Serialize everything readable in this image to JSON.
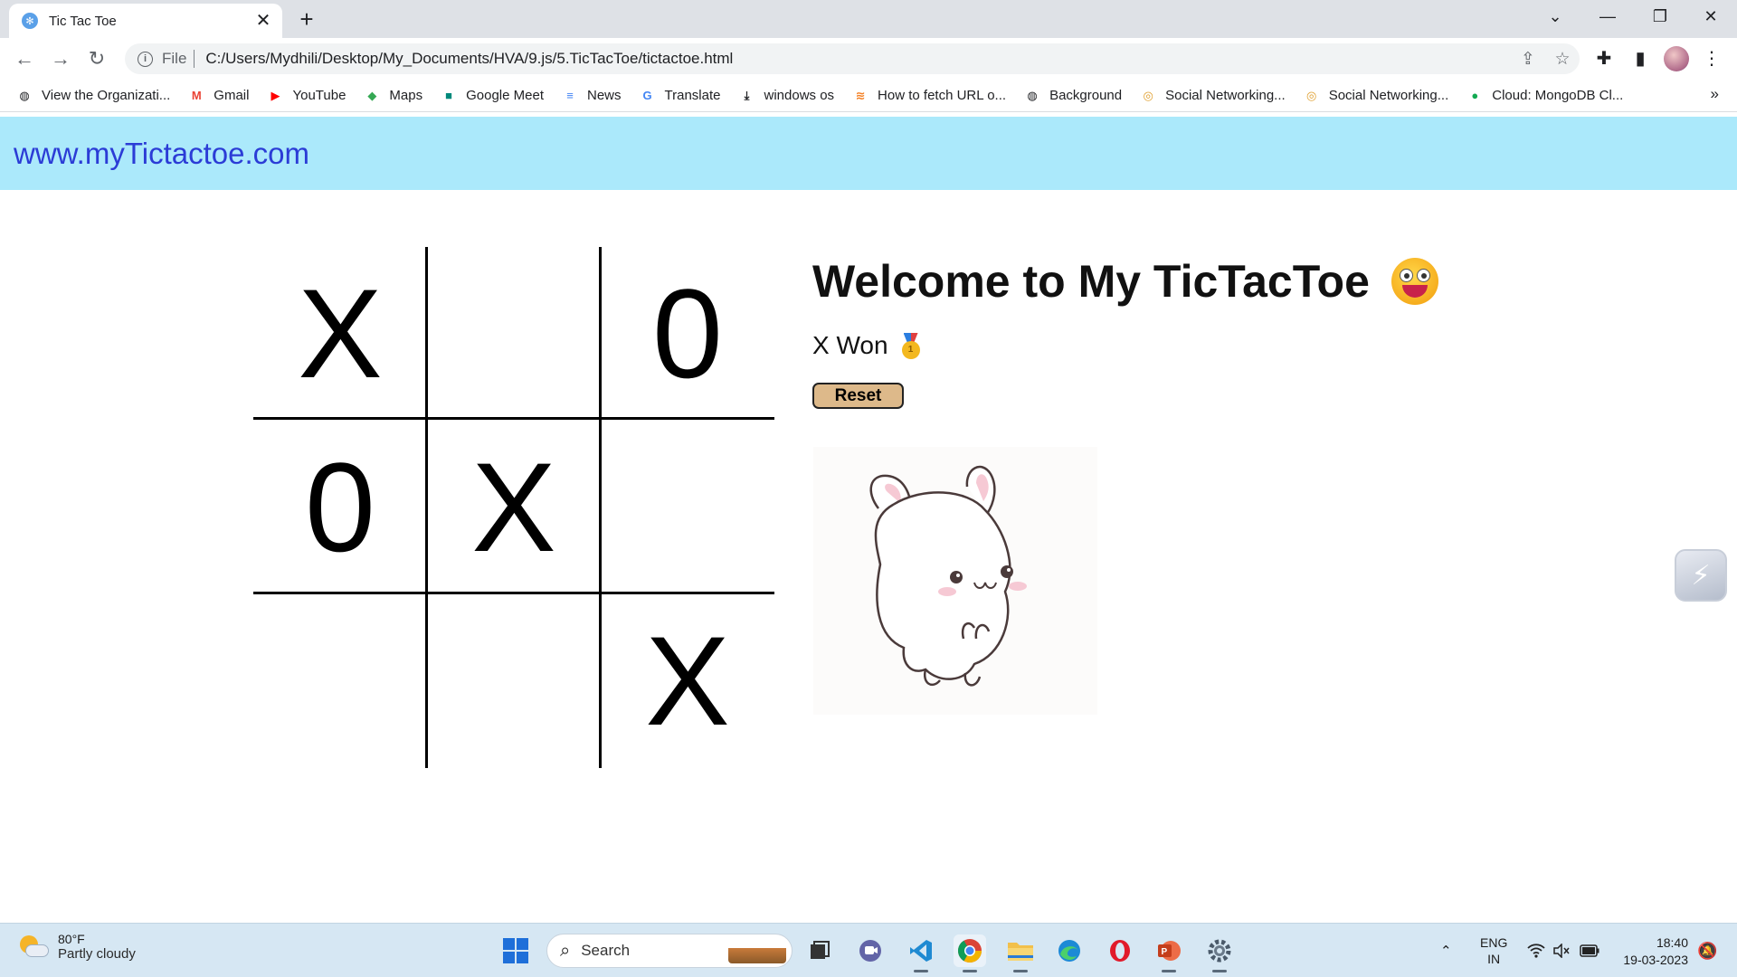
{
  "browser": {
    "tab_title": "Tic Tac Toe",
    "close_glyph": "✕",
    "new_tab_glyph": "+",
    "window_controls": [
      "⌄",
      "—",
      "❐",
      "✕"
    ],
    "nav": {
      "back": "←",
      "forward": "→",
      "reload": "↻"
    },
    "omnibox": {
      "scheme_label": "File",
      "url": "C:/Users/Mydhili/Desktop/My_Documents/HVA/9.js/5.TicTacToe/tictactoe.html"
    },
    "bookmarks": [
      {
        "label": "View the Organizati...",
        "icon": "globe-icon",
        "color": "#202124"
      },
      {
        "label": "Gmail",
        "icon": "gmail-icon",
        "color": "#ea4335"
      },
      {
        "label": "YouTube",
        "icon": "youtube-icon",
        "color": "#ff0000"
      },
      {
        "label": "Maps",
        "icon": "maps-icon",
        "color": "#34a853"
      },
      {
        "label": "Google Meet",
        "icon": "meet-icon",
        "color": "#00897b"
      },
      {
        "label": "News",
        "icon": "news-icon",
        "color": "#4285f4"
      },
      {
        "label": "Translate",
        "icon": "translate-icon",
        "color": "#4285f4"
      },
      {
        "label": "windows os",
        "icon": "download-icon",
        "color": "#202124"
      },
      {
        "label": "How to fetch URL o...",
        "icon": "stackoverflow-icon",
        "color": "#f48024"
      },
      {
        "label": "Background",
        "icon": "globe-icon",
        "color": "#202124"
      },
      {
        "label": "Social Networking...",
        "icon": "social-icon",
        "color": "#e0a030"
      },
      {
        "label": "Social Networking...",
        "icon": "social-icon",
        "color": "#e0a030"
      },
      {
        "label": "Cloud: MongoDB Cl...",
        "icon": "mongodb-icon",
        "color": "#13aa52"
      }
    ],
    "bookmarks_more": "»"
  },
  "site": {
    "header_link": "www.myTictactoe.com",
    "header_bg": "#abe9fb",
    "link_color": "#2b3cd6"
  },
  "game": {
    "board": [
      "X",
      "",
      "0",
      "0",
      "X",
      "",
      "",
      "",
      "X"
    ],
    "welcome": "Welcome to My TicTacToe",
    "status": "X Won",
    "reset_label": "Reset",
    "medal_number": "1"
  },
  "taskbar": {
    "weather_temp": "80°F",
    "weather_desc": "Partly cloudy",
    "search_label": "Search",
    "lang_top": "ENG",
    "lang_bottom": "IN",
    "time": "18:40",
    "date": "19-03-2023"
  }
}
